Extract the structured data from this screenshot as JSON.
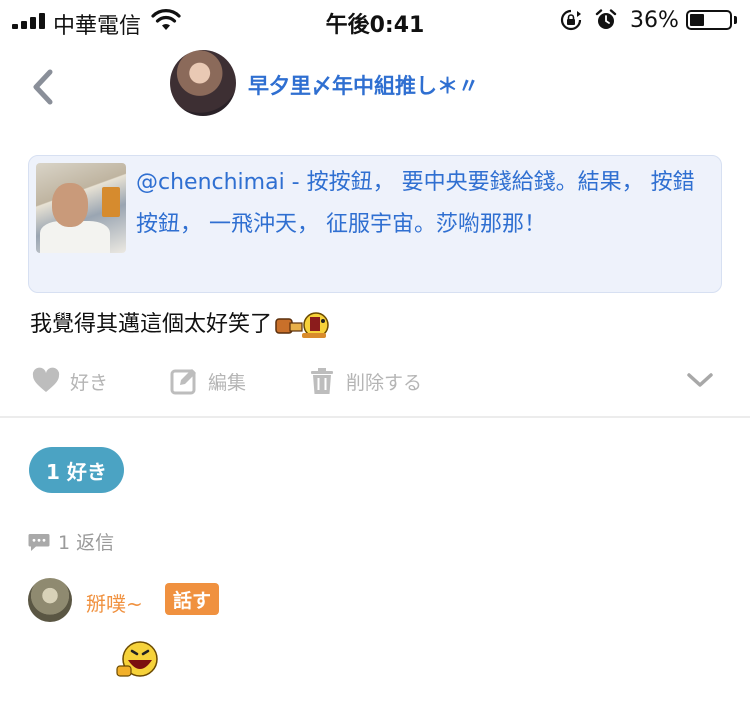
{
  "status_bar": {
    "carrier": "中華電信",
    "time": "午後0:41",
    "battery_percent": "36%",
    "battery_level": 0.36,
    "icons": [
      "signal-icon",
      "wifi-icon",
      "rotation-lock-icon",
      "alarm-icon",
      "battery-icon"
    ]
  },
  "header": {
    "back_icon": "chevron-left-icon",
    "user_name": "早夕里〆年中組推し＊〃"
  },
  "quote": {
    "text": "@chenchimai - 按按鈕， 要中央要錢給錢。結果， 按錯按鈕， 一飛沖天， 征服宇宙。莎喲那那！"
  },
  "post": {
    "text": "我覺得其邁這個太好笑了"
  },
  "actions": {
    "like_label": "好き",
    "edit_label": "編集",
    "delete_label": "削除する",
    "more_icon": "chevron-down-icon"
  },
  "likes": {
    "pill_label": "1 好き"
  },
  "replies": {
    "count_label": "1 返信",
    "items": [
      {
        "name": "掰噗~",
        "badge": "話す"
      }
    ]
  },
  "colors": {
    "link_blue": "#2f6fd1",
    "quote_bg": "#eef2fb",
    "like_pill": "#4ba3c3",
    "reply_orange": "#f0913f",
    "action_gray": "#b5b5b5"
  }
}
